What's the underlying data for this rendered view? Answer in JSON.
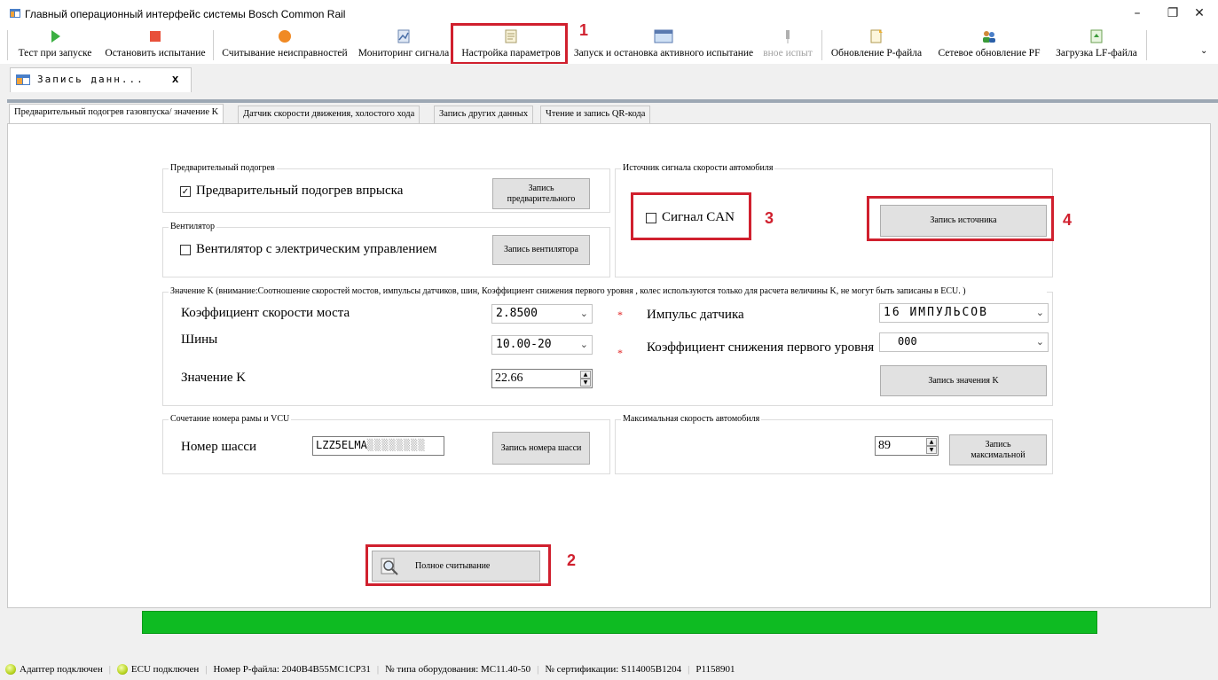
{
  "window": {
    "title": "Главный операционный интерфейс системы Bosch Common Rail",
    "minimize": "–",
    "restore": "❐",
    "close": "✕"
  },
  "toolbar": {
    "items": [
      {
        "label": "Тест при запуске",
        "icon": "play-icon",
        "color": "#3cb043"
      },
      {
        "label": "Остановить испытание",
        "icon": "stop-icon",
        "color": "#e8503a"
      },
      {
        "label": "Считывание неисправностей",
        "icon": "circle-icon",
        "color": "#f08a24"
      },
      {
        "label": "Мониторинг сигнала",
        "icon": "monitor-icon"
      },
      {
        "label": "Настройка параметров",
        "icon": "settings-doc-icon"
      },
      {
        "label": "Запуск и остановка активного испытание",
        "icon": "window-icon"
      },
      {
        "label": "вное испыт",
        "icon": "pin-icon"
      },
      {
        "label": "Обновление Р-файла",
        "icon": "file-update-icon"
      },
      {
        "label": "Сетевое обновление PF",
        "icon": "network-users-icon"
      },
      {
        "label": "Загрузка LF-файла",
        "icon": "file-load-icon"
      }
    ],
    "overflow": "⌄"
  },
  "doc_tab": {
    "label": "Запись данн...",
    "close": "x"
  },
  "tabs": [
    "Предварительный подогрев газовпуска/ значение K",
    "Датчик скорости движения, холостого хода",
    "Запись других данных",
    "Чтение и запись QR-кода"
  ],
  "preheat": {
    "group_title": "Предварительный подогрев",
    "checkbox_label": "Предварительный подогрев впрыска",
    "checked": true,
    "button": "Запись предварительного"
  },
  "fan": {
    "group_title": "Вентилятор",
    "checkbox_label": "Вентилятор с электрическим управлением",
    "checked": false,
    "button": "Запись вентилятора"
  },
  "speed_source": {
    "group_title": "Источник сигнала скорости автомобиля",
    "checkbox_label": "Сигнал CAN",
    "checked": false,
    "button": "Запись источника"
  },
  "k_value": {
    "group_title": "Значение K (внимание:Соотношение скоростей мостов, импульсы датчиков, шин, Коэффициент снижения первого уровня , колес используются только для расчета величины K, не могут быть записаны в ECU. )",
    "bridge_label": "Коэффициент скорости моста",
    "bridge_value": "2.8500",
    "tires_label": "Шины",
    "tires_value": "10.00-20",
    "k_label": "Значение K",
    "k_value": "22.66",
    "pulse_label": "Импульс датчика",
    "pulse_value": "16 ИМПУЛЬСОВ",
    "reduction_label": "Коэффициент снижения первого уровня",
    "reduction_value": "000",
    "star": "*",
    "button": "Запись значения K"
  },
  "chassis": {
    "group_title": "Сочетание номера рамы и VCU",
    "label": "Номер шасси",
    "value": "LZZ5ELMA",
    "button": "Запись номера шасси"
  },
  "max_speed": {
    "group_title": "Максимальная скорость автомобиля",
    "value": "89",
    "button": "Запись максимальной"
  },
  "full_read": {
    "button": "Полное считывание"
  },
  "annotations": [
    "1",
    "2",
    "3",
    "4"
  ],
  "progress": 1.0,
  "status": {
    "adapter": "Адаптер подключен",
    "ecu": "ECU подключен",
    "pfile": "Номер P-файла:  2040B4B55MC1CP31",
    "equip": "№ типа оборудования:  MC11.40-50",
    "cert": "№ сертификации:  S114005B1204",
    "p": "P1158901"
  },
  "colors": {
    "annotation_red": "#d0202e",
    "progress_green": "#0ebb22"
  }
}
